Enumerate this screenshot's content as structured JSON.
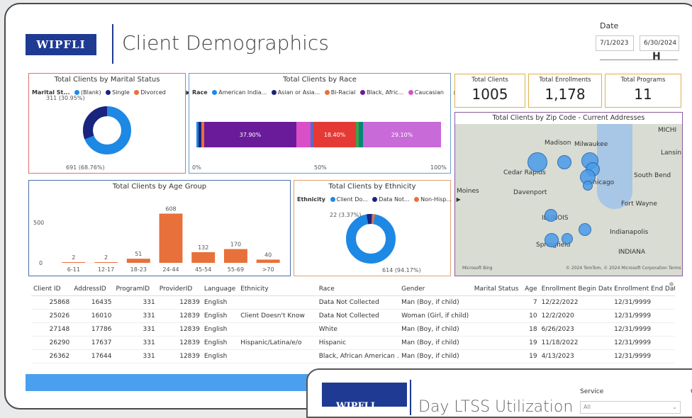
{
  "header": {
    "logo": "WIPFLI",
    "title": "Client Demographics",
    "date_label": "Date",
    "date_start": "7/1/2023",
    "date_end": "6/30/2024"
  },
  "marital": {
    "title": "Total Clients by Marital Status",
    "legend_label": "Marital St...",
    "legend_items": [
      "(Blank)",
      "Single",
      "Divorced"
    ],
    "label_top": "311 (30.95%)",
    "label_bottom": "691 (68.76%)"
  },
  "race": {
    "title": "Total Clients by Race",
    "legend_label": "Race",
    "legend_items": [
      "American India...",
      "Asian or Asia...",
      "Bi-Racial",
      "Black, Afric...",
      "Caucasian"
    ],
    "seg1": "37.90%",
    "seg2": "18.40%",
    "seg3": "29.10%",
    "axis": [
      "0%",
      "50%",
      "100%"
    ]
  },
  "kpis": [
    {
      "label": "Total Clients",
      "value": "1005"
    },
    {
      "label": "Total Enrollments",
      "value": "1,178"
    },
    {
      "label": "Total Programs",
      "value": "11"
    }
  ],
  "map": {
    "title": "Total Clients by Zip Code - Current Addresses",
    "cities": [
      "Madison",
      "Milwaukee",
      "MICHI",
      "Lansin",
      "Cedar Rapids",
      "South Bend",
      "Moines",
      "Davenport",
      "Chicago",
      "Fort Wayne",
      "ILLINOIS",
      "Indianapolis",
      "Springfield",
      "INDIANA"
    ],
    "attribution": "© 2024 TomTom, © 2024 Microsoft Corporation  Terms",
    "bing": "Microsoft Bing"
  },
  "age": {
    "title": "Total Clients by Age Group",
    "y_ticks": [
      "500",
      "0"
    ]
  },
  "ethnicity": {
    "title": "Total Clients by Ethnicity",
    "legend_label": "Ethnicity",
    "legend_items": [
      "Client Do...",
      "Data Not...",
      "Non-Hisp..."
    ],
    "label_top": "22 (3.37%)",
    "label_bottom": "614 (94.17%)"
  },
  "chart_data": {
    "type": "bar",
    "title": "Total Clients by Age Group",
    "categories": [
      "6-11",
      "12-17",
      "18-23",
      "24-44",
      "45-54",
      "55-69",
      ">70"
    ],
    "values": [
      2,
      2,
      51,
      608,
      132,
      170,
      40
    ],
    "ylim": [
      0,
      700
    ],
    "color": "#e8703a"
  },
  "table": {
    "headers": [
      "Client ID",
      "AddressID",
      "ProgramID",
      "ProviderID",
      "Language",
      "Ethnicity",
      "Race",
      "Gender",
      "Marital Status",
      "Age",
      "Enrollment Begin Date",
      "Enrollment End Date"
    ],
    "rows": [
      [
        "25868",
        "16435",
        "331",
        "12839",
        "English",
        "",
        "Data Not Collected",
        "Man (Boy, if child)",
        "",
        "7",
        "12/22/2022",
        "12/31/9999"
      ],
      [
        "25026",
        "16010",
        "331",
        "12839",
        "English",
        "Client Doesn't Know",
        "Data Not Collected",
        "Woman (Girl, if child)",
        "",
        "10",
        "12/2/2020",
        "12/31/9999"
      ],
      [
        "27148",
        "17786",
        "331",
        "12839",
        "English",
        "",
        "White",
        "Man (Boy, if child)",
        "",
        "18",
        "6/26/2023",
        "12/31/9999"
      ],
      [
        "26290",
        "17637",
        "331",
        "12839",
        "English",
        "Hispanic/Latina/e/o",
        "Hispanic",
        "Man (Boy, if child)",
        "",
        "19",
        "11/18/2022",
        "12/31/9999"
      ],
      [
        "26362",
        "17644",
        "331",
        "12839",
        "English",
        "",
        "Black, African American ...",
        "Man (Boy, if child)",
        "",
        "19",
        "4/13/2023",
        "12/31/9999"
      ]
    ]
  },
  "overlay": {
    "logo": "WIPFLI",
    "title": "Day LTSS Utilization",
    "service_label": "Service",
    "service_value": "All",
    "extra": "C"
  },
  "colors": {
    "accent": "#1f3a93",
    "bar": "#e8703a",
    "donut": "#1e88e5",
    "blue_bar": "#4aa0ee"
  }
}
